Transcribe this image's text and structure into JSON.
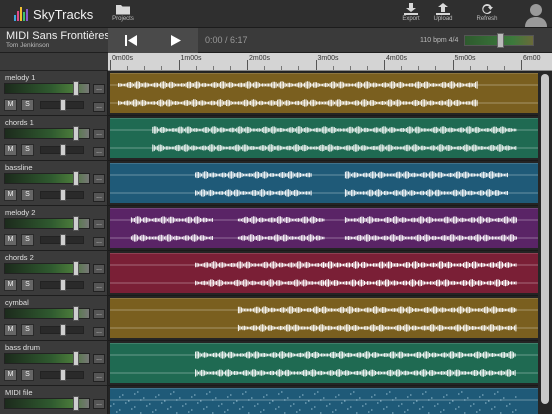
{
  "app": {
    "name": "SkyTracks",
    "logo_colors": [
      "#3ea8e0",
      "#e04a8a",
      "#f0c030",
      "#3ec070",
      "#8a5ad0"
    ]
  },
  "toolbar": {
    "projects_label": "Projects",
    "export_label": "Export",
    "upload_label": "Upload",
    "refresh_label": "Refresh"
  },
  "song": {
    "title": "MIDI Sans Frontières",
    "artist": "Tom Jenkinson"
  },
  "transport": {
    "rewind_icon": "skip-back-icon",
    "play_icon": "play-icon",
    "time": "0:00 / 6:17",
    "tempo": "110 bpm  4/4"
  },
  "master_volume": 0.52,
  "ruler": {
    "labels": [
      "0m00s",
      "1m00s",
      "2m00s",
      "3m00s",
      "4m00s",
      "5m00s",
      "6m00"
    ]
  },
  "tracks": [
    {
      "name": "melody 1",
      "color": "#7a5f1f",
      "volume": 0.82,
      "pan": 0.5,
      "mute_label": "M",
      "solo_label": "S",
      "menu_label": "..."
    },
    {
      "name": "chords 1",
      "color": "#1f6a52",
      "volume": 0.82,
      "pan": 0.5,
      "mute_label": "M",
      "solo_label": "S",
      "menu_label": "..."
    },
    {
      "name": "bassline",
      "color": "#1f5a78",
      "volume": 0.82,
      "pan": 0.5,
      "mute_label": "M",
      "solo_label": "S",
      "menu_label": "..."
    },
    {
      "name": "melody 2",
      "color": "#5a2466",
      "volume": 0.82,
      "pan": 0.5,
      "mute_label": "M",
      "solo_label": "S",
      "menu_label": "..."
    },
    {
      "name": "chords 2",
      "color": "#7a1f36",
      "volume": 0.82,
      "pan": 0.5,
      "mute_label": "M",
      "solo_label": "S",
      "menu_label": "..."
    },
    {
      "name": "cymbal",
      "color": "#7a5f1f",
      "volume": 0.82,
      "pan": 0.5,
      "mute_label": "M",
      "solo_label": "S",
      "menu_label": "..."
    },
    {
      "name": "bass drum",
      "color": "#1f6a52",
      "volume": 0.82,
      "pan": 0.5,
      "mute_label": "M",
      "solo_label": "S",
      "menu_label": "..."
    },
    {
      "name": "MIDI file",
      "color": "#1f5a78",
      "volume": 0.82,
      "pan": 0.5,
      "mute_label": "M",
      "solo_label": "S",
      "menu_label": "..."
    }
  ]
}
